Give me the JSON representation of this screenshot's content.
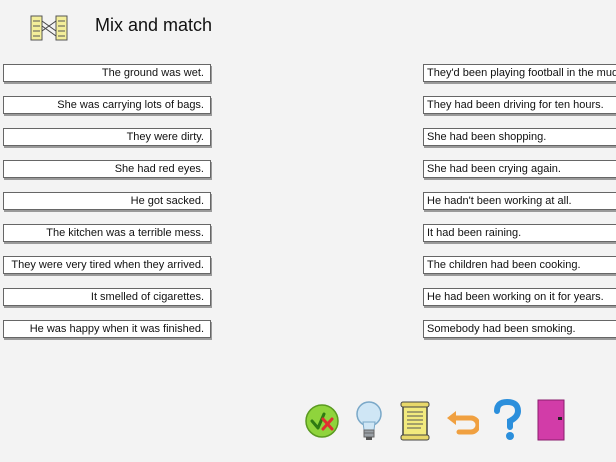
{
  "header": {
    "title": "Mix and match",
    "icon": "matching-columns-icon"
  },
  "left_items": [
    "The ground was wet.",
    "She was carrying lots of bags.",
    "They were dirty.",
    "She had red eyes.",
    "He got sacked.",
    "The kitchen was a terrible mess.",
    "They were very tired when they arrived.",
    "It smelled of cigarettes.",
    "He was happy when it was finished."
  ],
  "right_items": [
    "They'd been playing football in the mud.",
    "They had been driving for ten hours.",
    "She had been shopping.",
    "She had been crying again.",
    "He hadn't been working at all.",
    "It had been raining.",
    "The children had been cooking.",
    "He had been working on it for years.",
    "Somebody had been smoking."
  ],
  "toolbar": [
    {
      "name": "check-answers-button",
      "icon": "check-cross-icon"
    },
    {
      "name": "hint-button",
      "icon": "lightbulb-icon"
    },
    {
      "name": "instructions-button",
      "icon": "scroll-icon"
    },
    {
      "name": "reset-button",
      "icon": "undo-arrow-icon"
    },
    {
      "name": "help-button",
      "icon": "question-mark-icon"
    },
    {
      "name": "exit-button",
      "icon": "door-icon"
    }
  ],
  "colors": {
    "background": "#f3f3f3",
    "check": "#8fd43c",
    "cross": "#e03030",
    "bulb": "#cfe6f5",
    "scroll": "#f2ea7e",
    "undo": "#f0a040",
    "help": "#2b8fdc",
    "door": "#d23ca8"
  }
}
